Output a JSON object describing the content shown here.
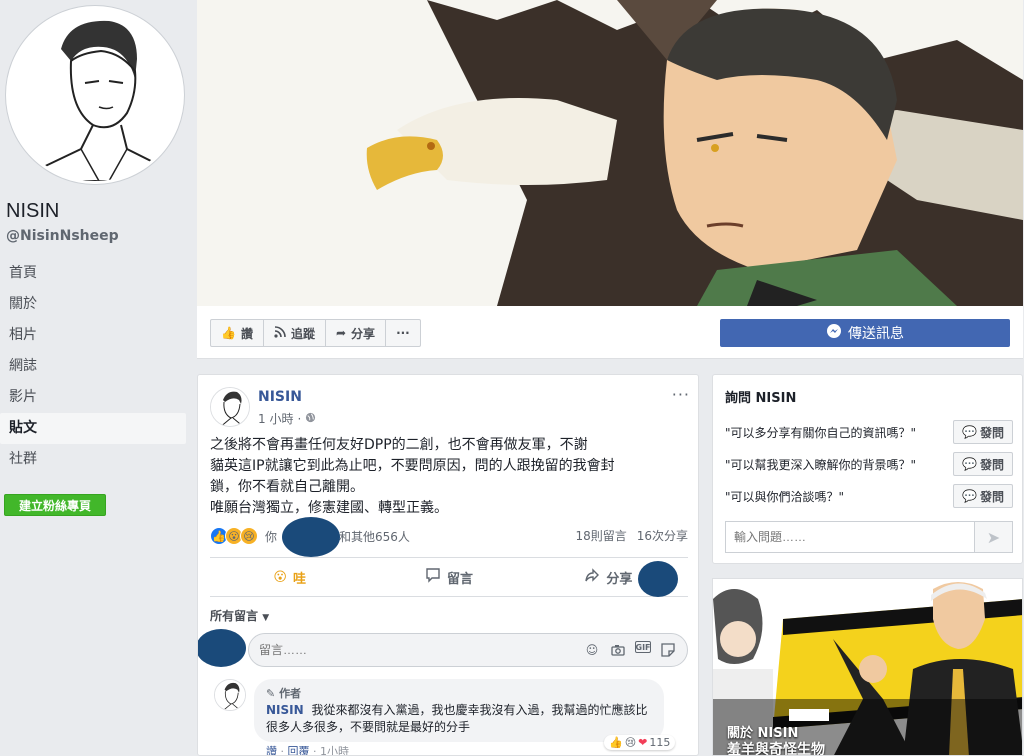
{
  "page": {
    "name": "NISIN",
    "handle": "@NisinNsheep",
    "nav": [
      "首頁",
      "關於",
      "相片",
      "網誌",
      "影片",
      "貼文",
      "社群"
    ],
    "active_nav": 5,
    "create_button": "建立粉絲專頁"
  },
  "action_bar": {
    "like": "讚",
    "follow": "追蹤",
    "share": "分享",
    "more": "···",
    "message": "傳送訊息"
  },
  "post": {
    "author": "NISIN",
    "time": "1 小時",
    "text_lines": [
      "之後將不會再畫任何友好DPP的二創，也不會再做友軍，不謝",
      "貓英這IP就讓它到此為止吧，不要問原因，問的人跟挽留的我會封",
      "鎖，你不看就自己離開。",
      "唯願台灣獨立，修憲建國、轉型正義。"
    ],
    "reaction_text_you": "你",
    "reaction_text_others": "和其他656人",
    "comments_count": "18則留言",
    "shares_count": "16次分享",
    "action_wow": "哇",
    "action_comment": "留言",
    "action_share": "分享",
    "all_comments": "所有留言",
    "comment_placeholder": "留言……",
    "comment": {
      "badge": "作者",
      "name": "NISIN",
      "text": "我從來都沒有入黨過，我也慶幸我沒有入過，我幫過的忙應該比很多人多很多，不要問就是最好的分手",
      "like": "讚",
      "reply": "回覆",
      "time": "1小時",
      "reaction_count": "115"
    }
  },
  "ask": {
    "title": "詢問 NISIN",
    "questions": [
      "\"可以多分享有關你自己的資訊嗎？\"",
      "\"可以幫我更深入瞭解你的背景嗎？\"",
      "\"可以與你們洽談嗎？\""
    ],
    "ask_button": "發問",
    "input_placeholder": "輸入問題……"
  },
  "about": {
    "label": "關於 NISIN",
    "subtitle": "羞羊與奇怪生物"
  },
  "colors": {
    "brand_blue": "#4267b2",
    "link_blue": "#385898",
    "create_green": "#42b72a",
    "background": "#e9ebee"
  }
}
